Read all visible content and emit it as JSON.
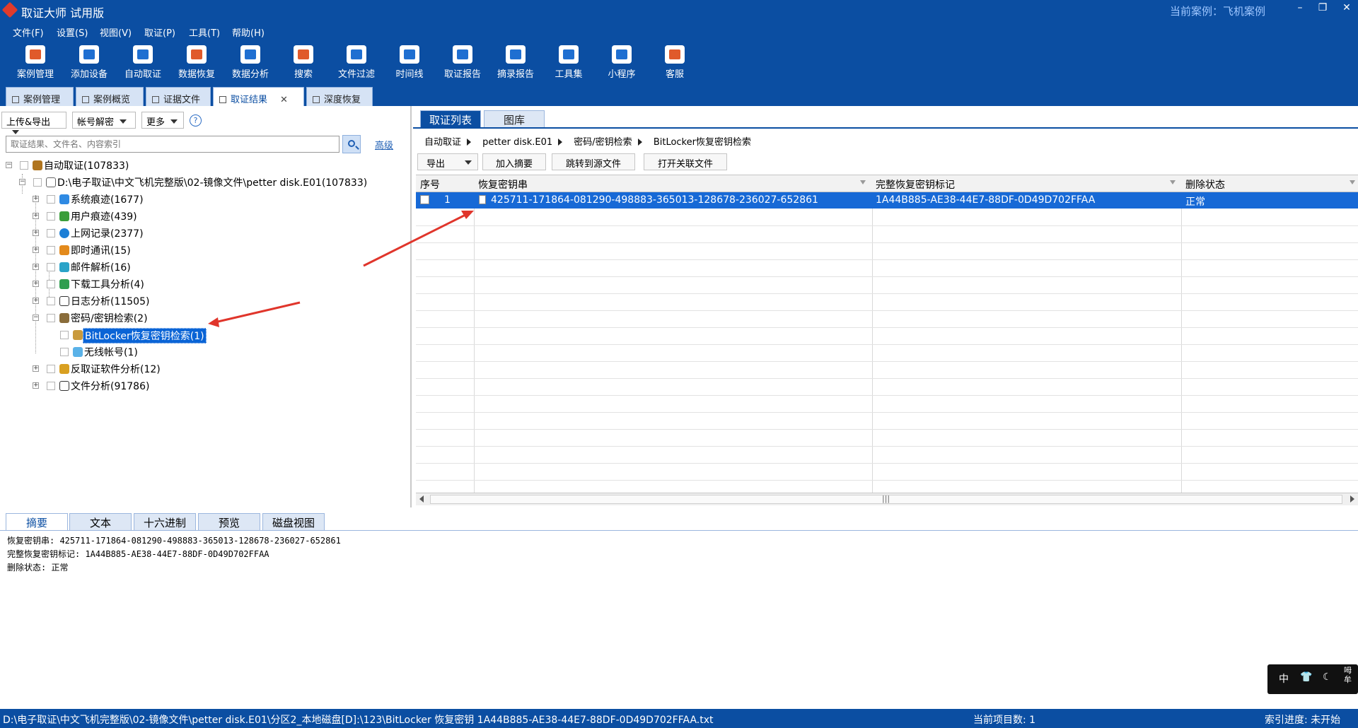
{
  "window": {
    "title": "取证大师 试用版",
    "current_case": "当前案例：飞机案例"
  },
  "menu": [
    "文件(F)",
    "设置(S)",
    "视图(V)",
    "取证(P)",
    "工具(T)",
    "帮助(H)"
  ],
  "toolbar": [
    "案例管理",
    "添加设备",
    "自动取证",
    "数据恢复",
    "数据分析",
    "搜索",
    "文件过滤",
    "时间线",
    "取证报告",
    "摘录报告",
    "工具集",
    "小程序",
    "客服"
  ],
  "tabs": [
    "案例管理",
    "案例概览",
    "证据文件",
    "取证结果",
    "深度恢复"
  ],
  "left": {
    "buttons": [
      "上传&导出",
      "帐号解密",
      "更多"
    ],
    "help": "?",
    "search_placeholder": "取证结果、文件名、内容索引",
    "advanced": "高级",
    "tree": [
      "自动取证(107833)",
      "D:\\电子取证\\中文飞机完整版\\02-镜像文件\\petter disk.E01(107833)",
      "系统痕迹(1677)",
      "用户痕迹(439)",
      "上网记录(2377)",
      "即时通讯(15)",
      "邮件解析(16)",
      "下载工具分析(4)",
      "日志分析(11505)",
      "密码/密钥检索(2)",
      "BitLocker恢复密钥检索(1)",
      "无线帐号(1)",
      "反取证软件分析(12)",
      "文件分析(91786)"
    ]
  },
  "right": {
    "tabs": [
      "取证列表",
      "图库"
    ],
    "breadcrumb": [
      "自动取证",
      "petter disk.E01",
      "密码/密钥检索",
      "BitLocker恢复密钥检索"
    ],
    "actions": [
      "导出",
      "加入摘要",
      "跳转到源文件",
      "打开关联文件"
    ],
    "columns": [
      "序号",
      "恢复密钥串",
      "完整恢复密钥标记",
      "删除状态"
    ],
    "rows": [
      {
        "index": "1",
        "key": "425711-171864-081290-498883-365013-128678-236027-652861",
        "tag": "1A44B885-AE38-44E7-88DF-0D49D702FFAA",
        "status": "正常"
      }
    ],
    "scroll_grip": "|||"
  },
  "bottom": {
    "tabs": [
      "摘要",
      "文本",
      "十六进制",
      "预览",
      "磁盘视图"
    ],
    "detail": [
      "恢复密钥串: 425711-171864-081290-498883-365013-128678-236027-652861",
      "完整恢复密钥标记: 1A44B885-AE38-44E7-88DF-0D49D702FFAA",
      "删除状态: 正常"
    ]
  },
  "ime": {
    "lang": "中",
    "extra": "呣\n牟"
  },
  "status": {
    "path": "D:\\电子取证\\中文飞机完整版\\02-镜像文件\\petter disk.E01\\分区2_本地磁盘[D]:\\123\\BitLocker 恢复密钥 1A44B885-AE38-44E7-88DF-0D49D702FFAA.txt",
    "count": "当前项目数: 1",
    "progress": "索引进度: 未开始"
  },
  "colors": {
    "primary": "#0b4ea2",
    "selection": "#1769d6",
    "annotation_arrow": "#e0352b"
  }
}
